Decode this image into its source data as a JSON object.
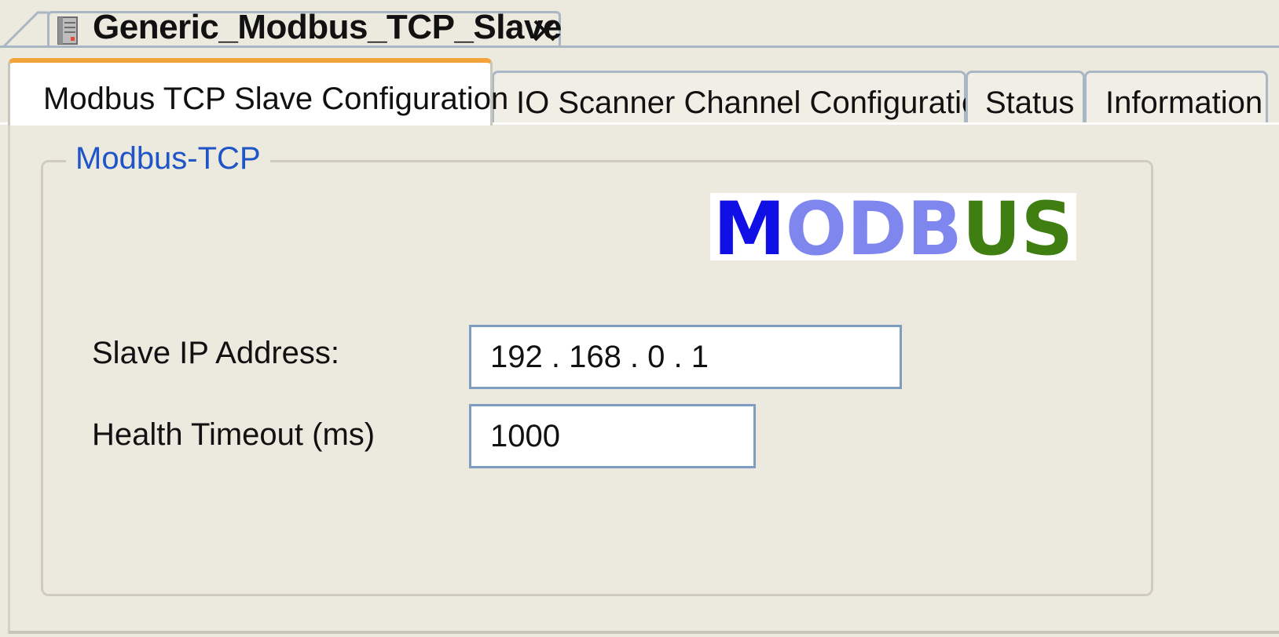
{
  "editor_tab": {
    "title": "Generic_Modbus_TCP_Slave",
    "icon": "device-icon",
    "close_icon": "close-icon"
  },
  "tabs": [
    {
      "label": "Modbus TCP Slave Configuration",
      "active": true
    },
    {
      "label": "IO Scanner Channel Configuration",
      "active": false
    },
    {
      "label": "Status",
      "active": false
    },
    {
      "label": "Information",
      "active": false
    }
  ],
  "group": {
    "legend": "Modbus-TCP",
    "logo_text": "MODBUS"
  },
  "fields": {
    "slave_ip": {
      "label": "Slave IP Address:",
      "value": "192 . 168 . 0 . 1"
    },
    "health_timeout": {
      "label": "Health Timeout (ms)",
      "value": "1000"
    }
  },
  "colors": {
    "background": "#ece9df",
    "legend": "#1f55c7",
    "active_tab_accent": "#f2a33a",
    "input_border": "#7f9cc1",
    "logo_blue": "#1010e6",
    "logo_light_blue": "#7f86ee",
    "logo_green": "#3f7f12"
  }
}
